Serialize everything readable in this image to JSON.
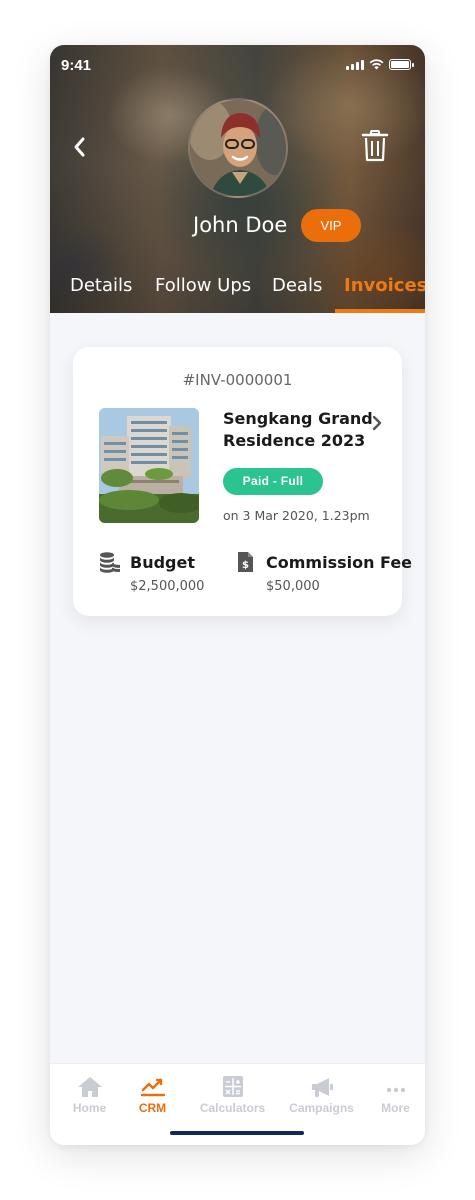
{
  "status_bar": {
    "time": "9:41"
  },
  "header": {
    "name": "John Doe",
    "badge": "VIP",
    "icons": {
      "back": "chevron-left-icon",
      "delete": "trash-icon"
    }
  },
  "tabs": [
    {
      "label": "Details",
      "active": false
    },
    {
      "label": "Follow Ups",
      "active": false
    },
    {
      "label": "Deals",
      "active": false
    },
    {
      "label": "Invoices",
      "active": true
    }
  ],
  "invoice": {
    "number": "#INV-0000001",
    "project_name": "Sengkang Grand Residence 2023",
    "status": "Paid - Full",
    "paid_on": "on 3 Mar 2020, 1.23pm",
    "budget_label": "Budget",
    "budget_value": "$2,500,000",
    "commission_label": "Commission Fee",
    "commission_value": "$50,000"
  },
  "bottom_nav": [
    {
      "label": "Home",
      "icon": "home-icon",
      "active": false
    },
    {
      "label": "CRM",
      "icon": "chart-line-icon",
      "active": true
    },
    {
      "label": "Calculators",
      "icon": "calculator-icon",
      "active": false
    },
    {
      "label": "Campaigns",
      "icon": "megaphone-icon",
      "active": false
    },
    {
      "label": "More",
      "icon": "more-dots-icon",
      "active": false
    }
  ],
  "colors": {
    "accent": "#ea6e0c",
    "paid": "#2bc38f",
    "background": "#f4f6fa",
    "home_indicator": "#0f2a5a"
  }
}
